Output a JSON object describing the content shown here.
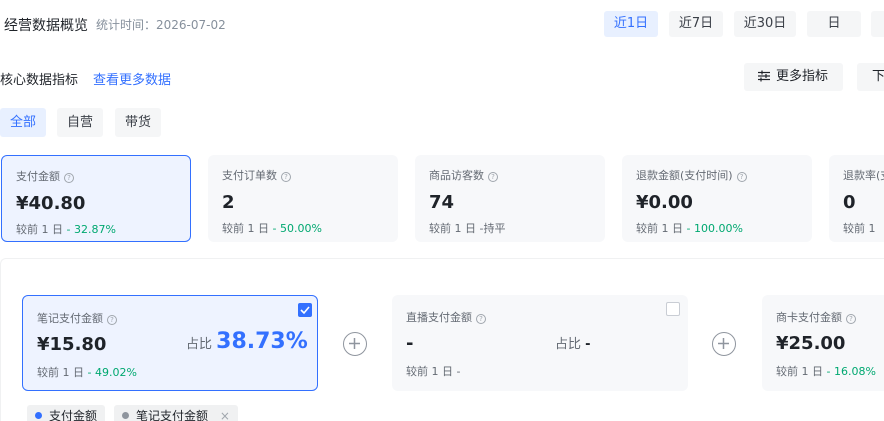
{
  "header": {
    "title": "经营数据概览",
    "stat_time": "统计时间：2026-07-02",
    "ranges": [
      {
        "label": "近1日",
        "active": true
      },
      {
        "label": "近7日",
        "active": false
      },
      {
        "label": "近30日",
        "active": false
      },
      {
        "label": "日",
        "active": false
      }
    ]
  },
  "section": {
    "title": "核心数据指标",
    "more_link": "查看更多数据",
    "more_metrics_label": "更多指标",
    "download_label": "下"
  },
  "filters": [
    {
      "label": "全部",
      "active": true
    },
    {
      "label": "自营",
      "active": false
    },
    {
      "label": "带货",
      "active": false
    }
  ],
  "metrics": [
    {
      "label": "支付金额",
      "value": "¥40.80",
      "cmp_prefix": "较前 1 日",
      "cmp": "- 32.87%",
      "active": true
    },
    {
      "label": "支付订单数",
      "value": "2",
      "cmp_prefix": "较前 1 日",
      "cmp": "- 50.00%",
      "active": false
    },
    {
      "label": "商品访客数",
      "value": "74",
      "cmp_prefix": "较前 1 日",
      "cmp": "-持平",
      "active": false
    },
    {
      "label": "退款金额(支付时间)",
      "value": "¥0.00",
      "cmp_prefix": "较前 1 日",
      "cmp": "- 100.00%",
      "active": false
    },
    {
      "label": "退款率(支",
      "value": "0",
      "cmp_prefix": "较前 1",
      "cmp": "",
      "active": false
    }
  ],
  "breakdown": [
    {
      "label": "笔记支付金额",
      "value": "¥15.80",
      "ratio_label": "占比",
      "ratio": "38.73%",
      "cmp_prefix": "较前 1 日",
      "cmp": "- 49.02%",
      "checked": true
    },
    {
      "label": "直播支付金额",
      "value": "-",
      "ratio_label": "占比",
      "ratio": "-",
      "cmp_prefix": "较前 1 日",
      "cmp": "-",
      "checked": false
    },
    {
      "label": "商卡支付金额",
      "value": "¥25.00",
      "cmp_prefix": "较前 1 日",
      "cmp": "- 16.08%"
    }
  ],
  "legend": [
    {
      "label": "支付金额",
      "color": "#3370ff"
    },
    {
      "label": "笔记支付金额",
      "color": "#8f959e",
      "closable": true
    }
  ],
  "icons": {
    "question": "?",
    "close": "×"
  }
}
